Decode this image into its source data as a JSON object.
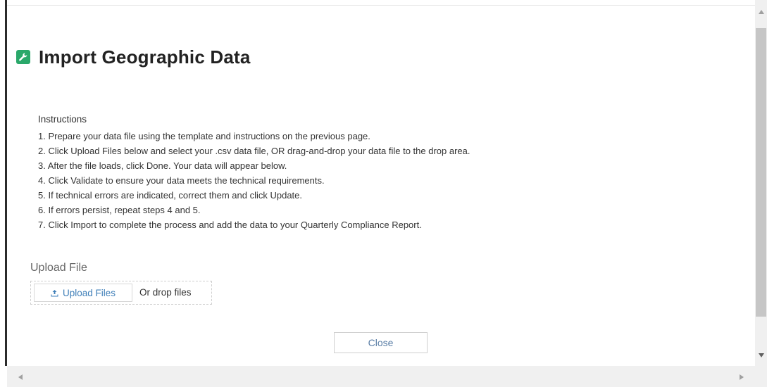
{
  "dialog": {
    "title": "Import Geographic Data",
    "title_icon": "wrench-icon",
    "accent_color": "#2aa86a"
  },
  "instructions": {
    "heading": "Instructions",
    "steps": [
      "1. Prepare your data file using the template and instructions on the previous page.",
      "2. Click Upload Files below and select your .csv data file, OR drag-and-drop your data file to the drop area.",
      "3. After the file loads, click Done. Your data will appear below.",
      "4. Click Validate to ensure your data meets the technical requirements.",
      "5. If technical errors are indicated, correct them and click Update.",
      "6. If errors persist, repeat steps 4 and 5.",
      "7. Click Import to complete the process and add the data to your Quarterly Compliance Report."
    ]
  },
  "upload": {
    "label": "Upload File",
    "button_label": "Upload Files",
    "button_icon": "upload-icon",
    "drop_text": "Or drop files"
  },
  "footer": {
    "close_label": "Close"
  }
}
